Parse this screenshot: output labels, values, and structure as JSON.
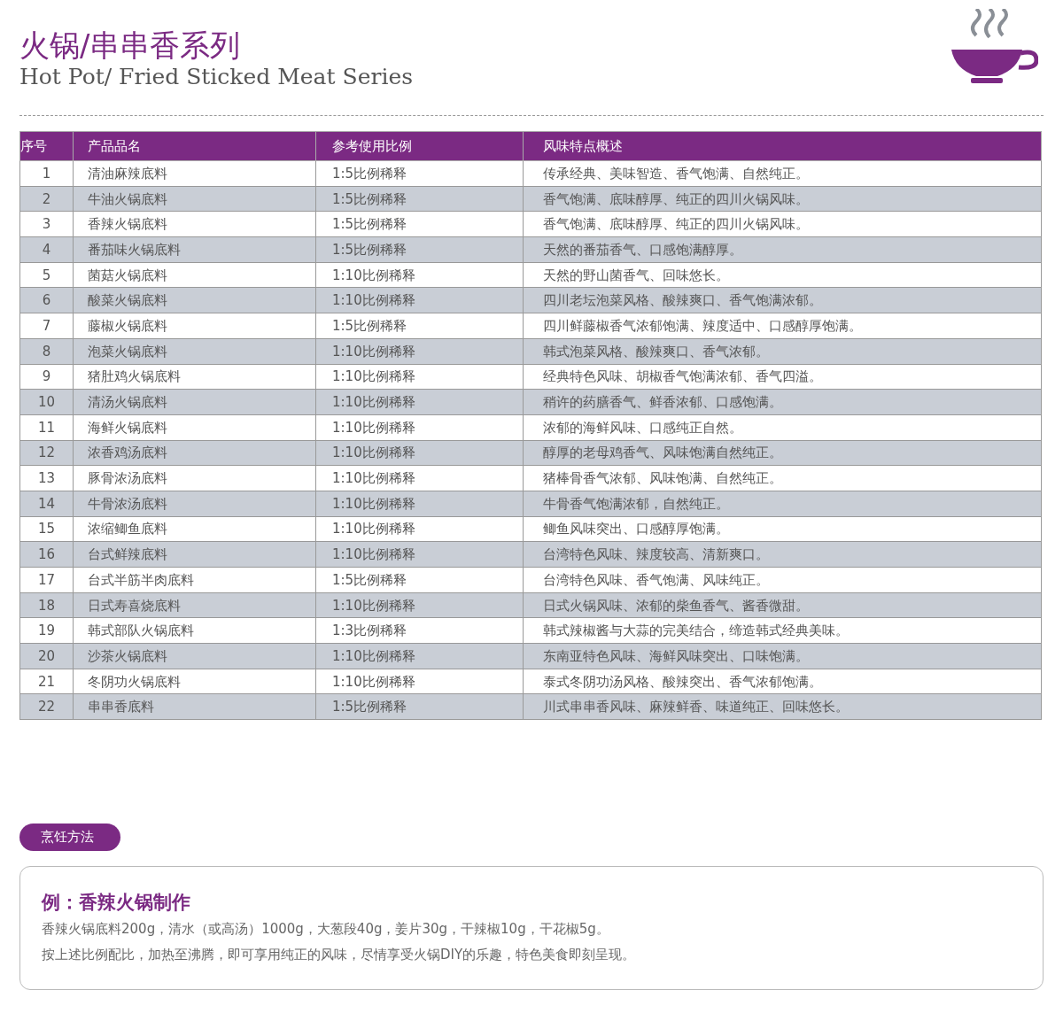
{
  "header": {
    "title": "火锅/串串香系列",
    "subtitle": "Hot Pot/ Fried Sticked Meat Series"
  },
  "table": {
    "columns": [
      "序号",
      "产品品名",
      "参考使用比例",
      "风味特点概述"
    ],
    "rows": [
      [
        "1",
        "清油麻辣底料",
        "1:5比例稀释",
        "传承经典、美味智造、香气饱满、自然纯正。"
      ],
      [
        "2",
        "牛油火锅底料",
        "1:5比例稀释",
        "香气饱满、底味醇厚、纯正的四川火锅风味。"
      ],
      [
        "3",
        "香辣火锅底料",
        "1:5比例稀释",
        "香气饱满、底味醇厚、纯正的四川火锅风味。"
      ],
      [
        "4",
        "番茄味火锅底料",
        "1:5比例稀释",
        "天然的番茄香气、口感饱满醇厚。"
      ],
      [
        "5",
        "菌菇火锅底料",
        "1:10比例稀释",
        "天然的野山菌香气、回味悠长。"
      ],
      [
        "6",
        "酸菜火锅底料",
        "1:10比例稀释",
        "四川老坛泡菜风格、酸辣爽口、香气饱满浓郁。"
      ],
      [
        "7",
        "藤椒火锅底料",
        "1:5比例稀释",
        "四川鲜藤椒香气浓郁饱满、辣度适中、口感醇厚饱满。"
      ],
      [
        "8",
        "泡菜火锅底料",
        "1:10比例稀释",
        "韩式泡菜风格、酸辣爽口、香气浓郁。"
      ],
      [
        "9",
        "猪肚鸡火锅底料",
        "1:10比例稀释",
        "经典特色风味、胡椒香气饱满浓郁、香气四溢。"
      ],
      [
        "10",
        "清汤火锅底料",
        "1:10比例稀释",
        "稍许的药膳香气、鲜香浓郁、口感饱满。"
      ],
      [
        "11",
        "海鲜火锅底料",
        "1:10比例稀释",
        "浓郁的海鲜风味、口感纯正自然。"
      ],
      [
        "12",
        "浓香鸡汤底料",
        "1:10比例稀释",
        "醇厚的老母鸡香气、风味饱满自然纯正。"
      ],
      [
        "13",
        "豚骨浓汤底料",
        "1:10比例稀释",
        "猪棒骨香气浓郁、风味饱满、自然纯正。"
      ],
      [
        "14",
        "牛骨浓汤底料",
        "1:10比例稀释",
        "牛骨香气饱满浓郁，自然纯正。"
      ],
      [
        "15",
        "浓缩鲫鱼底料",
        "1:10比例稀释",
        "鲫鱼风味突出、口感醇厚饱满。"
      ],
      [
        "16",
        "台式鲜辣底料",
        "1:10比例稀释",
        "台湾特色风味、辣度较高、清新爽口。"
      ],
      [
        "17",
        "台式半筋半肉底料",
        "1:5比例稀释",
        "台湾特色风味、香气饱满、风味纯正。"
      ],
      [
        "18",
        "日式寿喜烧底料",
        "1:10比例稀释",
        "日式火锅风味、浓郁的柴鱼香气、酱香微甜。"
      ],
      [
        "19",
        "韩式部队火锅底料",
        "1:3比例稀释",
        "韩式辣椒酱与大蒜的完美结合，缔造韩式经典美味。"
      ],
      [
        "20",
        "沙茶火锅底料",
        "1:10比例稀释",
        "东南亚特色风味、海鲜风味突出、口味饱满。"
      ],
      [
        "21",
        "冬阴功火锅底料",
        "1:10比例稀释",
        "泰式冬阴功汤风格、酸辣突出、香气浓郁饱满。"
      ],
      [
        "22",
        "串串香底料",
        "1:5比例稀释",
        "川式串串香风味、麻辣鲜香、味道纯正、回味悠长。"
      ]
    ]
  },
  "cooking": {
    "badge": "烹饪方法",
    "title": "例：香辣火锅制作",
    "lines": [
      "香辣火锅底料200g，清水（或高汤）1000g，大葱段40g，姜片30g，干辣椒10g，干花椒5g。",
      "按上述比例配比，加热至沸腾，即可享用纯正的风味，尽情享受火锅DIY的乐趣，特色美食即刻呈现。"
    ]
  }
}
